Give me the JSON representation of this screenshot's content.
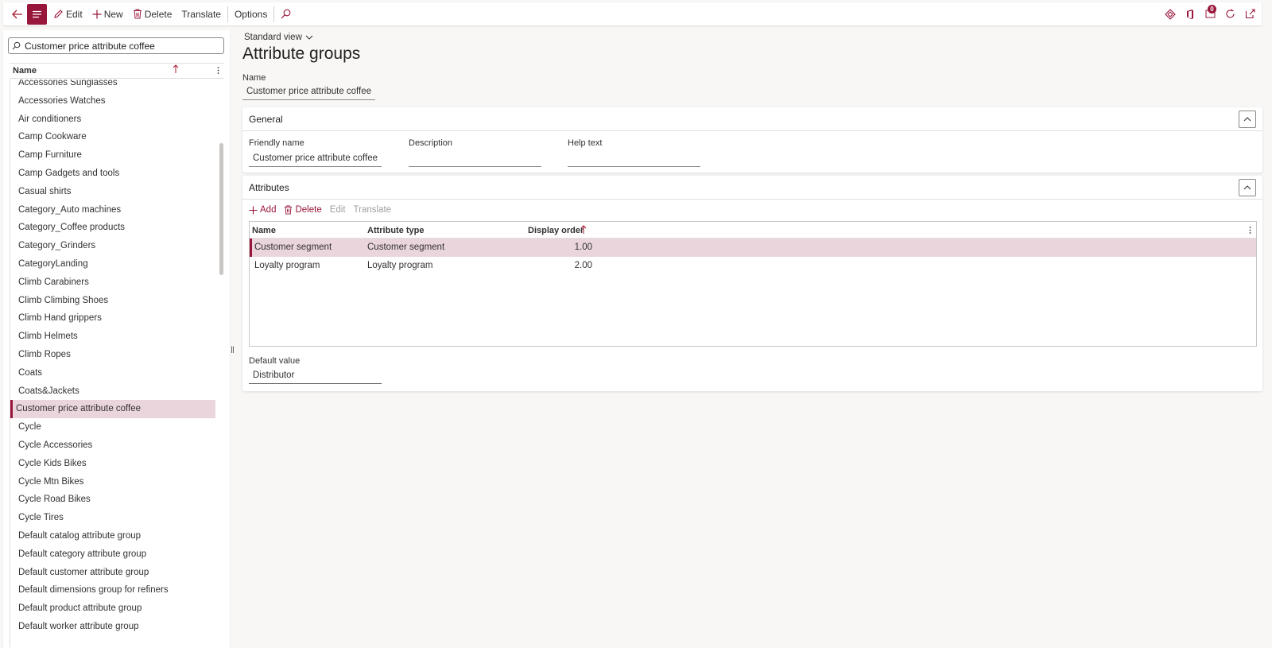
{
  "toolbar": {
    "edit_label": "Edit",
    "new_label": "New",
    "delete_label": "Delete",
    "translate_label": "Translate",
    "options_label": "Options",
    "notification_count": "0"
  },
  "list": {
    "search_value": "Customer price attribute coffee",
    "column_header": "Name",
    "items": [
      "Accessories Sunglasses",
      "Accessories Watches",
      "Air conditioners",
      "Camp Cookware",
      "Camp Furniture",
      "Camp Gadgets and tools",
      "Casual shirts",
      "Category_Auto machines",
      "Category_Coffee products",
      "Category_Grinders",
      "CategoryLanding",
      "Climb Carabiners",
      "Climb Climbing Shoes",
      "Climb Hand grippers",
      "Climb Helmets",
      "Climb Ropes",
      "Coats",
      "Coats&Jackets",
      "Customer price attribute coffee",
      "Cycle",
      "Cycle Accessories",
      "Cycle Kids Bikes",
      "Cycle Mtn Bikes",
      "Cycle Road Bikes",
      "Cycle Tires",
      "Default catalog attribute group",
      "Default category attribute group",
      "Default customer attribute group",
      "Default dimensions group for refiners",
      "Default product attribute group",
      "Default worker attribute group"
    ],
    "selected_index": 18
  },
  "main": {
    "view_label": "Standard view",
    "page_title": "Attribute groups",
    "name_label": "Name",
    "name_value": "Customer price attribute coffee"
  },
  "general": {
    "title": "General",
    "friendly_name_label": "Friendly name",
    "friendly_name_value": "Customer price attribute coffee",
    "description_label": "Description",
    "description_value": "",
    "help_text_label": "Help text",
    "help_text_value": ""
  },
  "attributes": {
    "title": "Attributes",
    "add_label": "Add",
    "delete_label": "Delete",
    "edit_label": "Edit",
    "translate_label": "Translate",
    "columns": [
      "Name",
      "Attribute type",
      "Display order"
    ],
    "rows": [
      {
        "name": "Customer segment",
        "type": "Customer segment",
        "order": "1.00"
      },
      {
        "name": "Loyalty program",
        "type": "Loyalty program",
        "order": "2.00"
      }
    ],
    "default_value_label": "Default value",
    "default_value": "Distributor"
  },
  "colors": {
    "accent": "#98163a",
    "selected_row": "#ead5dd"
  }
}
